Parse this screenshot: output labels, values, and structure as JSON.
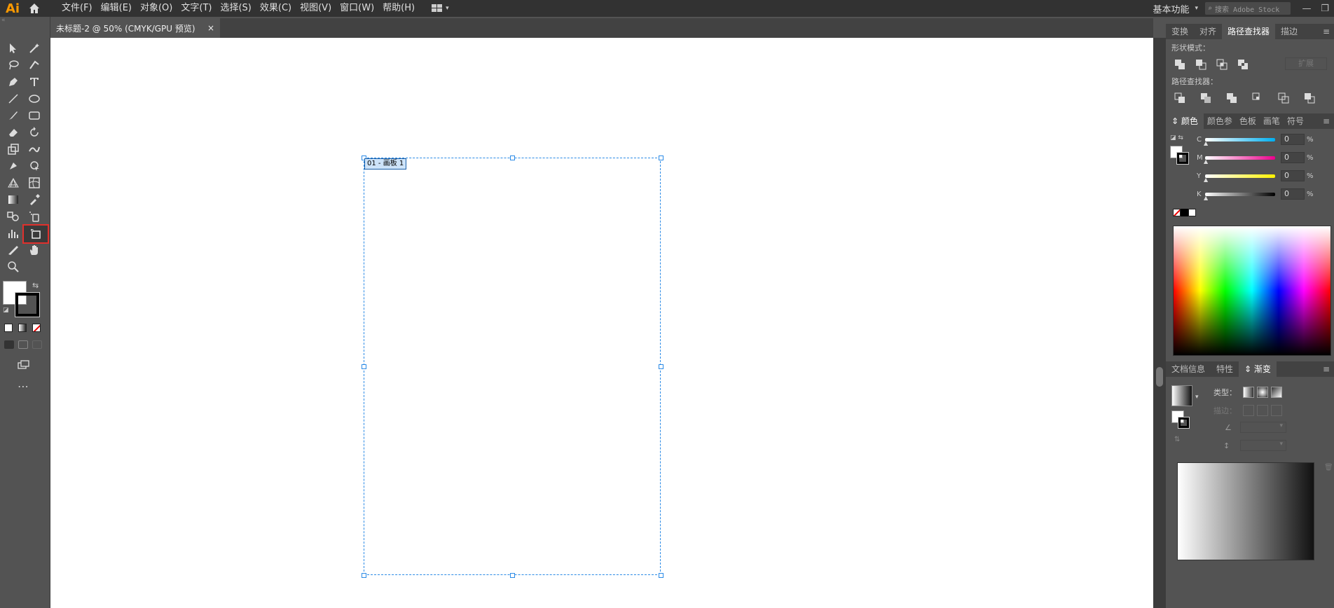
{
  "app": {
    "logo": "Ai"
  },
  "menu": [
    "文件(F)",
    "编辑(E)",
    "对象(O)",
    "文字(T)",
    "选择(S)",
    "效果(C)",
    "视图(V)",
    "窗口(W)",
    "帮助(H)"
  ],
  "workspace": {
    "label": "基本功能",
    "search_placeholder": "搜索 Adobe Stock"
  },
  "document": {
    "tab_title": "未标题-2 @ 50% (CMYK/GPU 预览)",
    "close": "×"
  },
  "artboard": {
    "label": "01 - 画板 1"
  },
  "panel_top": {
    "tabs": [
      "变换",
      "对齐",
      "路径查找器",
      "描边"
    ],
    "active": 2,
    "shape_modes": "形状模式：",
    "expand": "扩展",
    "pathfinders": "路径查找器："
  },
  "color_panel": {
    "tabs": [
      "颜色",
      "颜色参",
      "色板",
      "画笔",
      "符号"
    ],
    "active": 0,
    "channels": [
      {
        "name": "C",
        "value": "0",
        "unit": "%",
        "color": "#00aeef"
      },
      {
        "name": "M",
        "value": "0",
        "unit": "%",
        "color": "#ec008c"
      },
      {
        "name": "Y",
        "value": "0",
        "unit": "%",
        "color": "#fff200"
      },
      {
        "name": "K",
        "value": "0",
        "unit": "%",
        "color": "#000000"
      }
    ]
  },
  "gradient_panel": {
    "tabs": [
      "文档信息",
      "特性",
      "渐变"
    ],
    "active": 2,
    "type_label": "类型：",
    "stroke_label": "描边："
  }
}
